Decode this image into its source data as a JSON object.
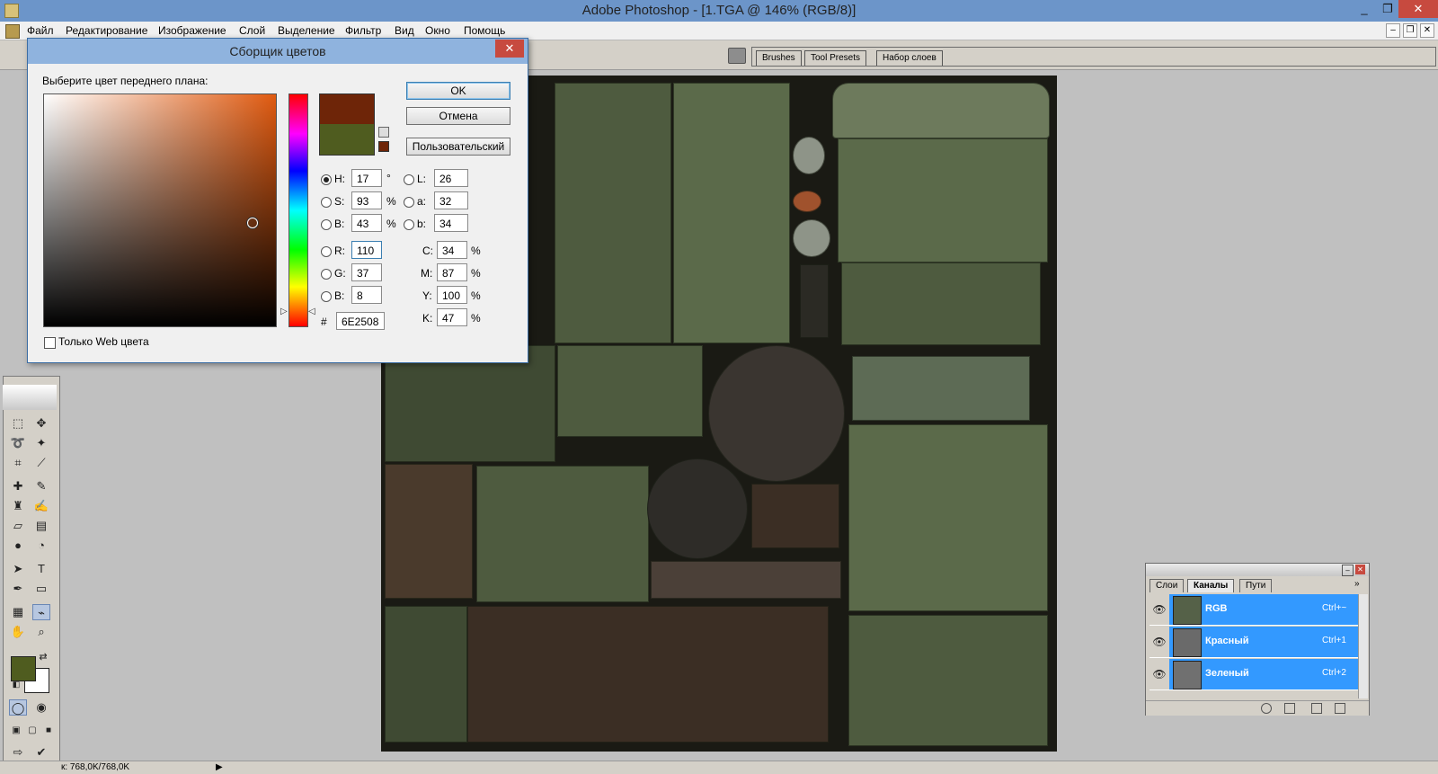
{
  "window": {
    "title": "Adobe Photoshop - [1.TGA @ 146% (RGB/8)]",
    "controls": {
      "minimize": "_",
      "maximize": "❐",
      "close": "✕"
    }
  },
  "menu": [
    "Файл",
    "Редактирование",
    "Изображение",
    "Слой",
    "Выделение",
    "Фильтр",
    "Вид",
    "Окно",
    "Помощь"
  ],
  "palette_well": {
    "tabs": [
      "Brushes",
      "Tool Presets",
      "Набор слоев"
    ]
  },
  "color_picker": {
    "title": "Сборщик цветов",
    "prompt": "Выберите цвет переднего плана:",
    "buttons": {
      "ok": "OK",
      "cancel": "Отмена",
      "custom": "Пользовательский"
    },
    "new_color": "#6E2508",
    "old_color": "#4F5C1F",
    "hsb": {
      "h": {
        "label": "H:",
        "value": "17",
        "unit": "°",
        "selected": true
      },
      "s": {
        "label": "S:",
        "value": "93",
        "unit": "%"
      },
      "b": {
        "label": "B:",
        "value": "43",
        "unit": "%"
      }
    },
    "rgb": {
      "r": {
        "label": "R:",
        "value": "110"
      },
      "g": {
        "label": "G:",
        "value": "37"
      },
      "b": {
        "label": "B:",
        "value": "8"
      }
    },
    "lab": {
      "l": {
        "label": "L:",
        "value": "26"
      },
      "a": {
        "label": "a:",
        "value": "32"
      },
      "b": {
        "label": "b:",
        "value": "34"
      }
    },
    "cmyk": {
      "c": {
        "label": "C:",
        "value": "34",
        "unit": "%"
      },
      "m": {
        "label": "M:",
        "value": "87",
        "unit": "%"
      },
      "y": {
        "label": "Y:",
        "value": "100",
        "unit": "%"
      },
      "k": {
        "label": "K:",
        "value": "47",
        "unit": "%"
      }
    },
    "hex": {
      "label": "#",
      "value": "6E2508"
    },
    "web_only": {
      "label": "Только Web цвета",
      "checked": false
    }
  },
  "toolbox": {
    "foreground": "#4F5C1F",
    "background": "#FFFFFF",
    "tools": [
      "marquee-tool",
      "move-tool",
      "lasso-tool",
      "magic-wand-tool",
      "crop-tool",
      "slice-tool",
      "healing-brush-tool",
      "brush-tool",
      "clone-stamp-tool",
      "history-brush-tool",
      "eraser-tool",
      "gradient-tool",
      "blur-tool",
      "dodge-tool",
      "path-selection-tool",
      "type-tool",
      "pen-tool",
      "shape-tool",
      "notes-tool",
      "eyedropper-tool",
      "hand-tool",
      "zoom-tool"
    ]
  },
  "channels_panel": {
    "tabs": [
      "Слои",
      "Каналы",
      "Пути"
    ],
    "active_tab": "Каналы",
    "rows": [
      {
        "name": "RGB",
        "shortcut": "Ctrl+~"
      },
      {
        "name": "Красный",
        "shortcut": "Ctrl+1"
      },
      {
        "name": "Зеленый",
        "shortcut": "Ctrl+2"
      }
    ]
  },
  "status": {
    "text": "к: 768,0K/768,0K"
  }
}
